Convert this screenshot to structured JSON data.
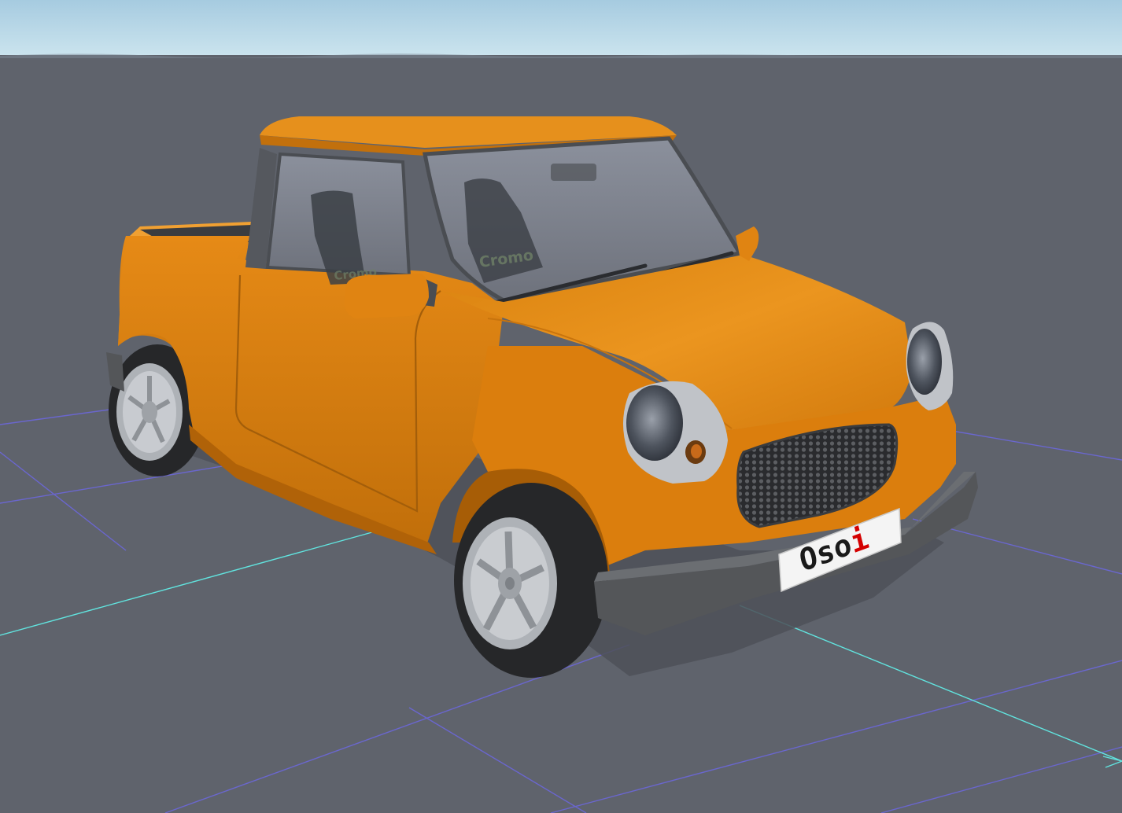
{
  "scene": {
    "colors": {
      "sky_top": "#a9cde0",
      "sky_bottom": "#c9e3ee",
      "ground": "#5f636c",
      "grid_line": "#6c67e0",
      "axis_line": "#61e4df",
      "body": "#e08412",
      "body_dark": "#b96709",
      "bumper": "#545659",
      "tire": "#262729",
      "wheel_rim": "#b9bcc0"
    }
  },
  "vehicle": {
    "seat_brand_primary": "Cromo",
    "seat_brand_secondary": "Cromo",
    "license_plate": {
      "prefix": "Oso",
      "suffix": "i",
      "prefix_color": "#1a1a1a",
      "suffix_color": "#d40000"
    }
  }
}
